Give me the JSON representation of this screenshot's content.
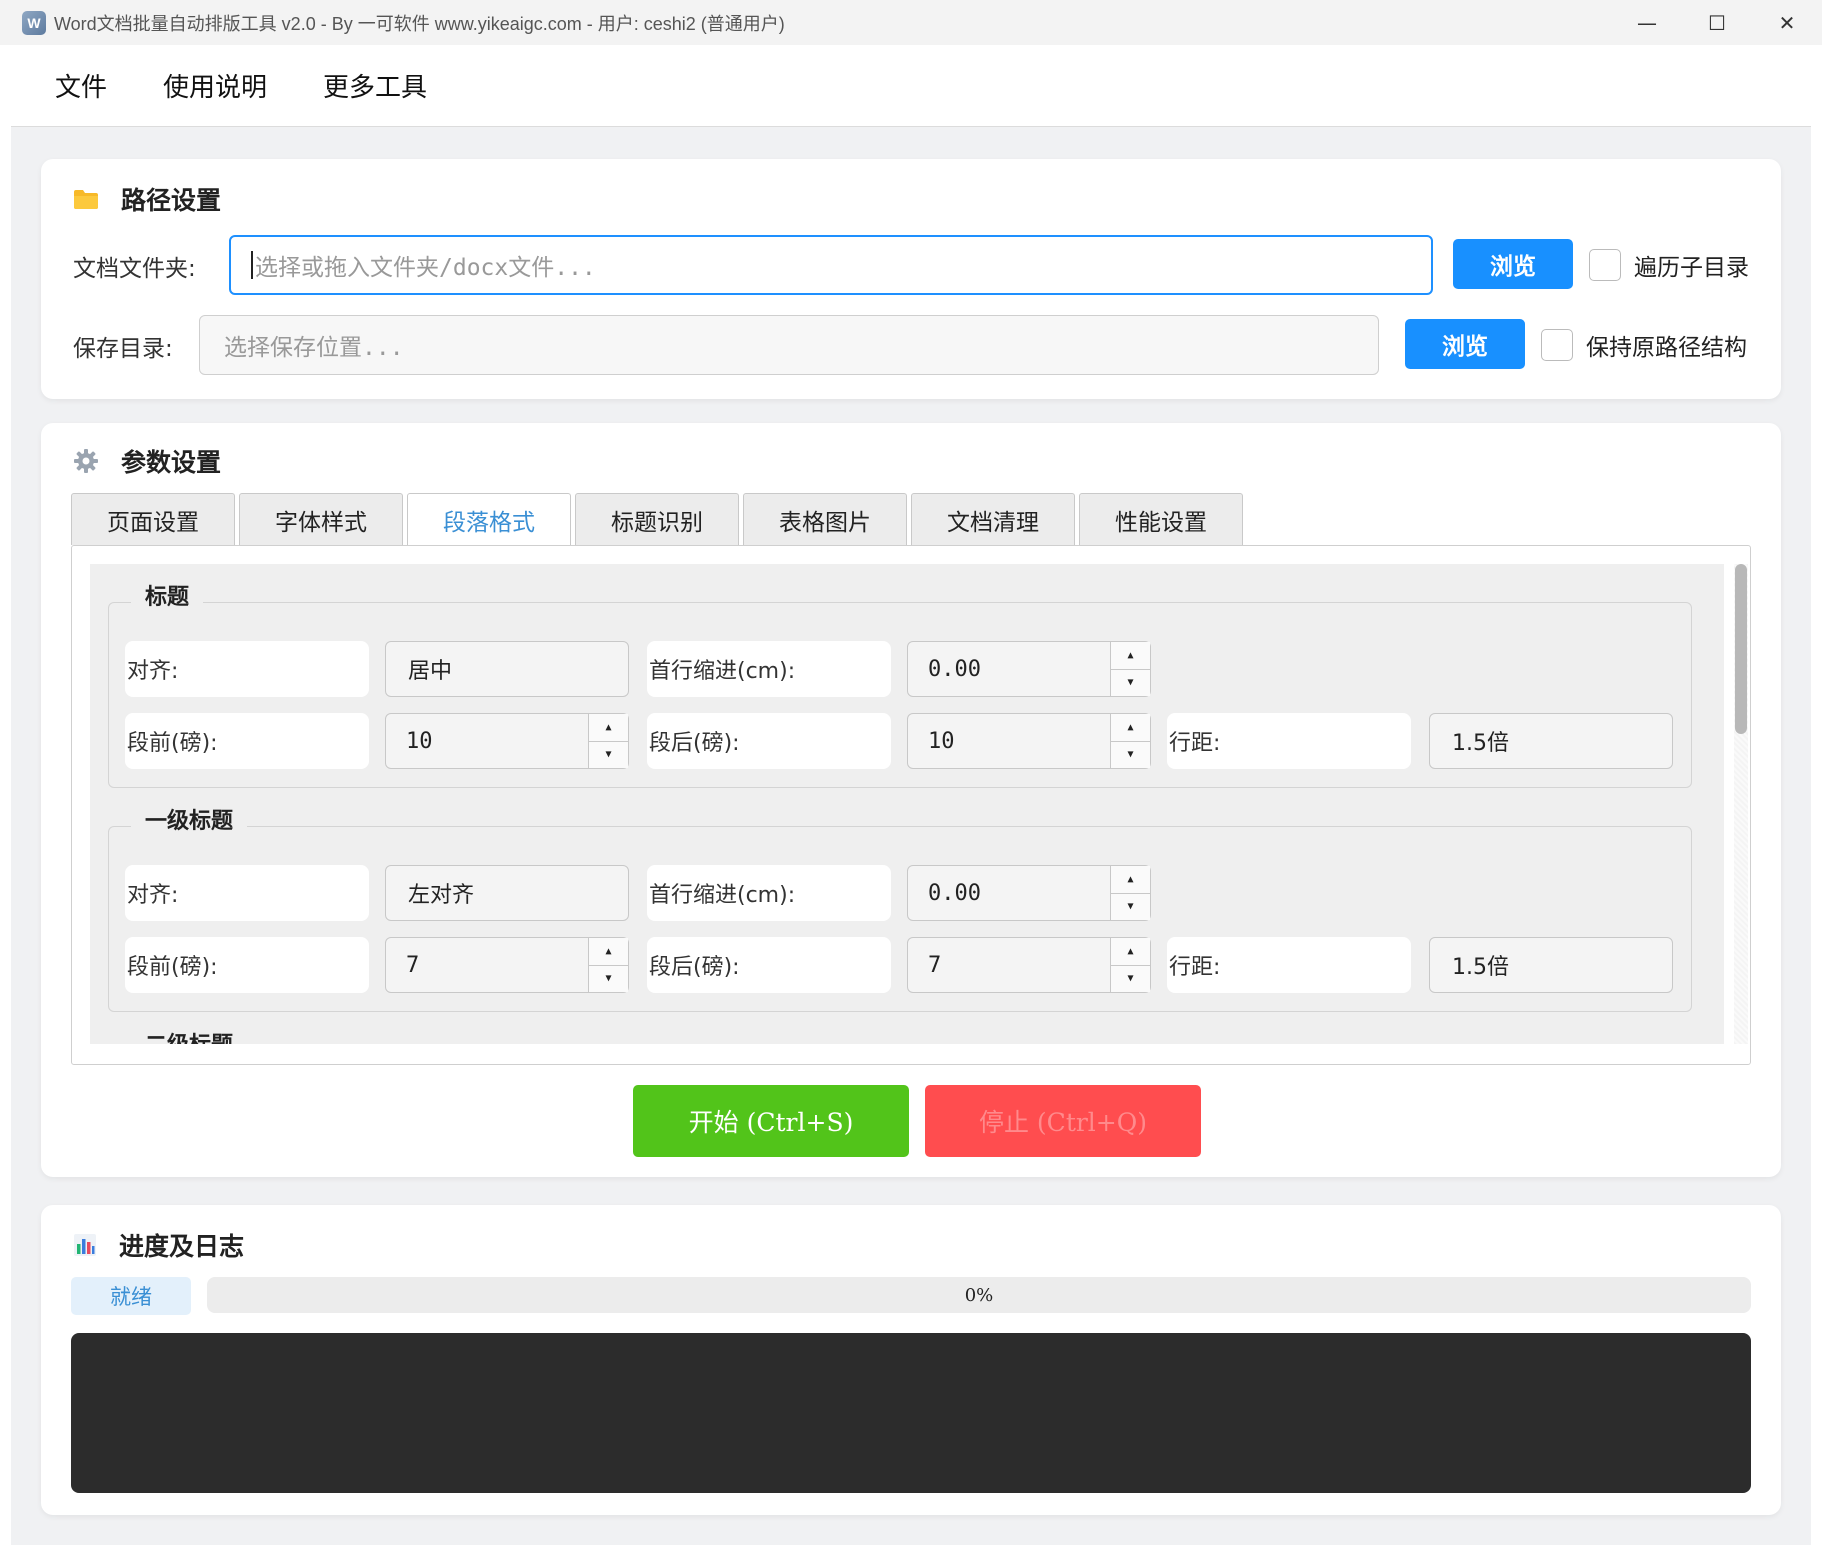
{
  "window": {
    "title": "Word文档批量自动排版工具 v2.0 - By 一可软件 www.yikeaigc.com - 用户: ceshi2 (普通用户)",
    "minimize": "—",
    "maximize": "☐",
    "close": "✕"
  },
  "menu": [
    "文件",
    "使用说明",
    "更多工具"
  ],
  "path_section": {
    "title": "路径设置",
    "doc_folder_label": "文档文件夹:",
    "doc_folder_placeholder": "选择或拖入文件夹/docx文件...",
    "browse1": "浏览",
    "recurse_label": "遍历子目录",
    "save_dir_label": "保存目录:",
    "save_dir_placeholder": "选择保存位置...",
    "browse2": "浏览",
    "keep_structure_label": "保持原路径结构"
  },
  "params_section": {
    "title": "参数设置",
    "tabs": [
      "页面设置",
      "字体样式",
      "段落格式",
      "标题识别",
      "表格图片",
      "文档清理",
      "性能设置"
    ],
    "active_tab": "段落格式",
    "groups": [
      {
        "title": "标题",
        "align_label": "对齐:",
        "align_value": "居中",
        "indent_label": "首行缩进(cm):",
        "indent_value": "0.00",
        "before_label": "段前(磅):",
        "before_value": "10",
        "after_label": "段后(磅):",
        "after_value": "10",
        "spacing_label": "行距:",
        "spacing_value": "1.5倍"
      },
      {
        "title": "一级标题",
        "align_label": "对齐:",
        "align_value": "左对齐",
        "indent_label": "首行缩进(cm):",
        "indent_value": "0.00",
        "before_label": "段前(磅):",
        "before_value": "7",
        "after_label": "段后(磅):",
        "after_value": "7",
        "spacing_label": "行距:",
        "spacing_value": "1.5倍"
      },
      {
        "title": "二级标题"
      }
    ],
    "start_button": "开始 (Ctrl+S)",
    "stop_button": "停止 (Ctrl+Q)"
  },
  "progress_section": {
    "title": "进度及日志",
    "status": "就绪",
    "progress_text": "0%",
    "progress_value": 0
  },
  "colors": {
    "accent": "#1890ff",
    "start": "#52c41a",
    "stop": "#ff4d4f",
    "log_bg": "#2c2c2c"
  }
}
